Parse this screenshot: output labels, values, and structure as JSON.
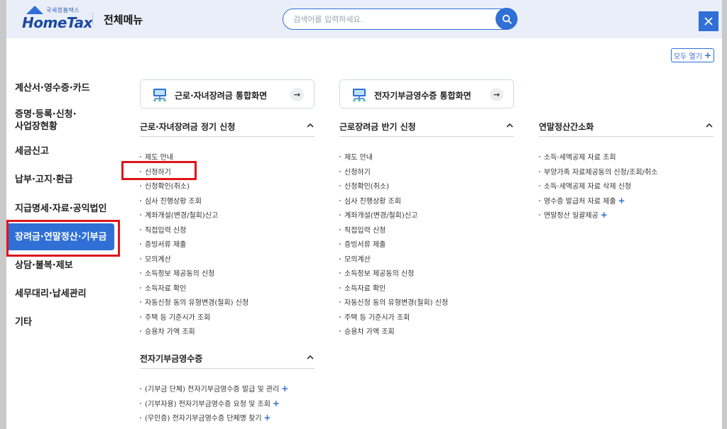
{
  "header": {
    "logo_small": "국세청홈택스",
    "logo_main": "HomeTax",
    "title": "전체메뉴",
    "search_placeholder": "검색어를 입력하세요.",
    "expand_all_label": "모두 열기"
  },
  "sidebar": {
    "items": [
      {
        "label": "계산서·영수증·카드"
      },
      {
        "label": "증명·등록·신청·\n사업장현황"
      },
      {
        "label": "세금신고"
      },
      {
        "label": "납부·고지·환급"
      },
      {
        "label": "지급명세·자료·공익법인"
      },
      {
        "label": "장려금·연말정산·기부금",
        "active": true
      },
      {
        "label": "상담·불복·제보"
      },
      {
        "label": "세무대리·납세관리"
      },
      {
        "label": "기타"
      }
    ]
  },
  "quick_links": [
    {
      "label": "근로·자녀장려금 통합화면"
    },
    {
      "label": "전자기부금영수증 통합화면"
    }
  ],
  "sections": {
    "regular": {
      "title": "근로·자녀장려금 정기 신청",
      "items": [
        "제도 안내",
        "신청하기",
        "신청확인(취소)",
        "심사 진행상황 조회",
        "계좌개설(변경/철회)신고",
        "직접입력 신청",
        "증빙서류 제출",
        "모의계산",
        "소득정보 제공동의 신청",
        "소득자료 확인",
        "자동신청 동의 유형변경(철회) 신청",
        "주택 등 기준시가 조회",
        "승용차 가액 조회"
      ]
    },
    "half": {
      "title": "근로장려금 반기 신청",
      "items": [
        "제도 안내",
        "신청하기",
        "신청확인(취소)",
        "심사 진행상황 조회",
        "계좌개설(변경/철회)신고",
        "직접입력 신청",
        "증빙서류 제출",
        "모의계산",
        "소득정보 제공동의 신청",
        "소득자료 확인",
        "자동신청 동의 유형변경(철회) 신청",
        "주택 등 기준시가 조회",
        "승용차 가액 조회"
      ]
    },
    "yearend": {
      "title": "연말정산간소화",
      "items": [
        {
          "label": "소득·세액공제 자료 조회",
          "plus": false
        },
        {
          "label": "부양가족 자료제공동의 신청/조회/취소",
          "plus": false
        },
        {
          "label": "소득·세액공제 자료 삭제 신청",
          "plus": false
        },
        {
          "label": "영수증 발급처 자료 제출",
          "plus": true
        },
        {
          "label": "연말정산 일괄제공",
          "plus": true
        }
      ]
    },
    "donation": {
      "title": "전자기부금영수증",
      "items": [
        {
          "label": "(기부금 단체) 전자기부금영수증 발급 및 관리",
          "plus": true
        },
        {
          "label": "(기부자용) 전자기부금영수증 요청 및 조회",
          "plus": true
        },
        {
          "label": "(무인증) 전자기부금영수증 단체명 찾기",
          "plus": true
        }
      ]
    }
  },
  "plus_symbol": "+",
  "arrow_symbol": "→",
  "colors": {
    "accent": "#2f6fd6",
    "highlight": "#e0141b"
  }
}
